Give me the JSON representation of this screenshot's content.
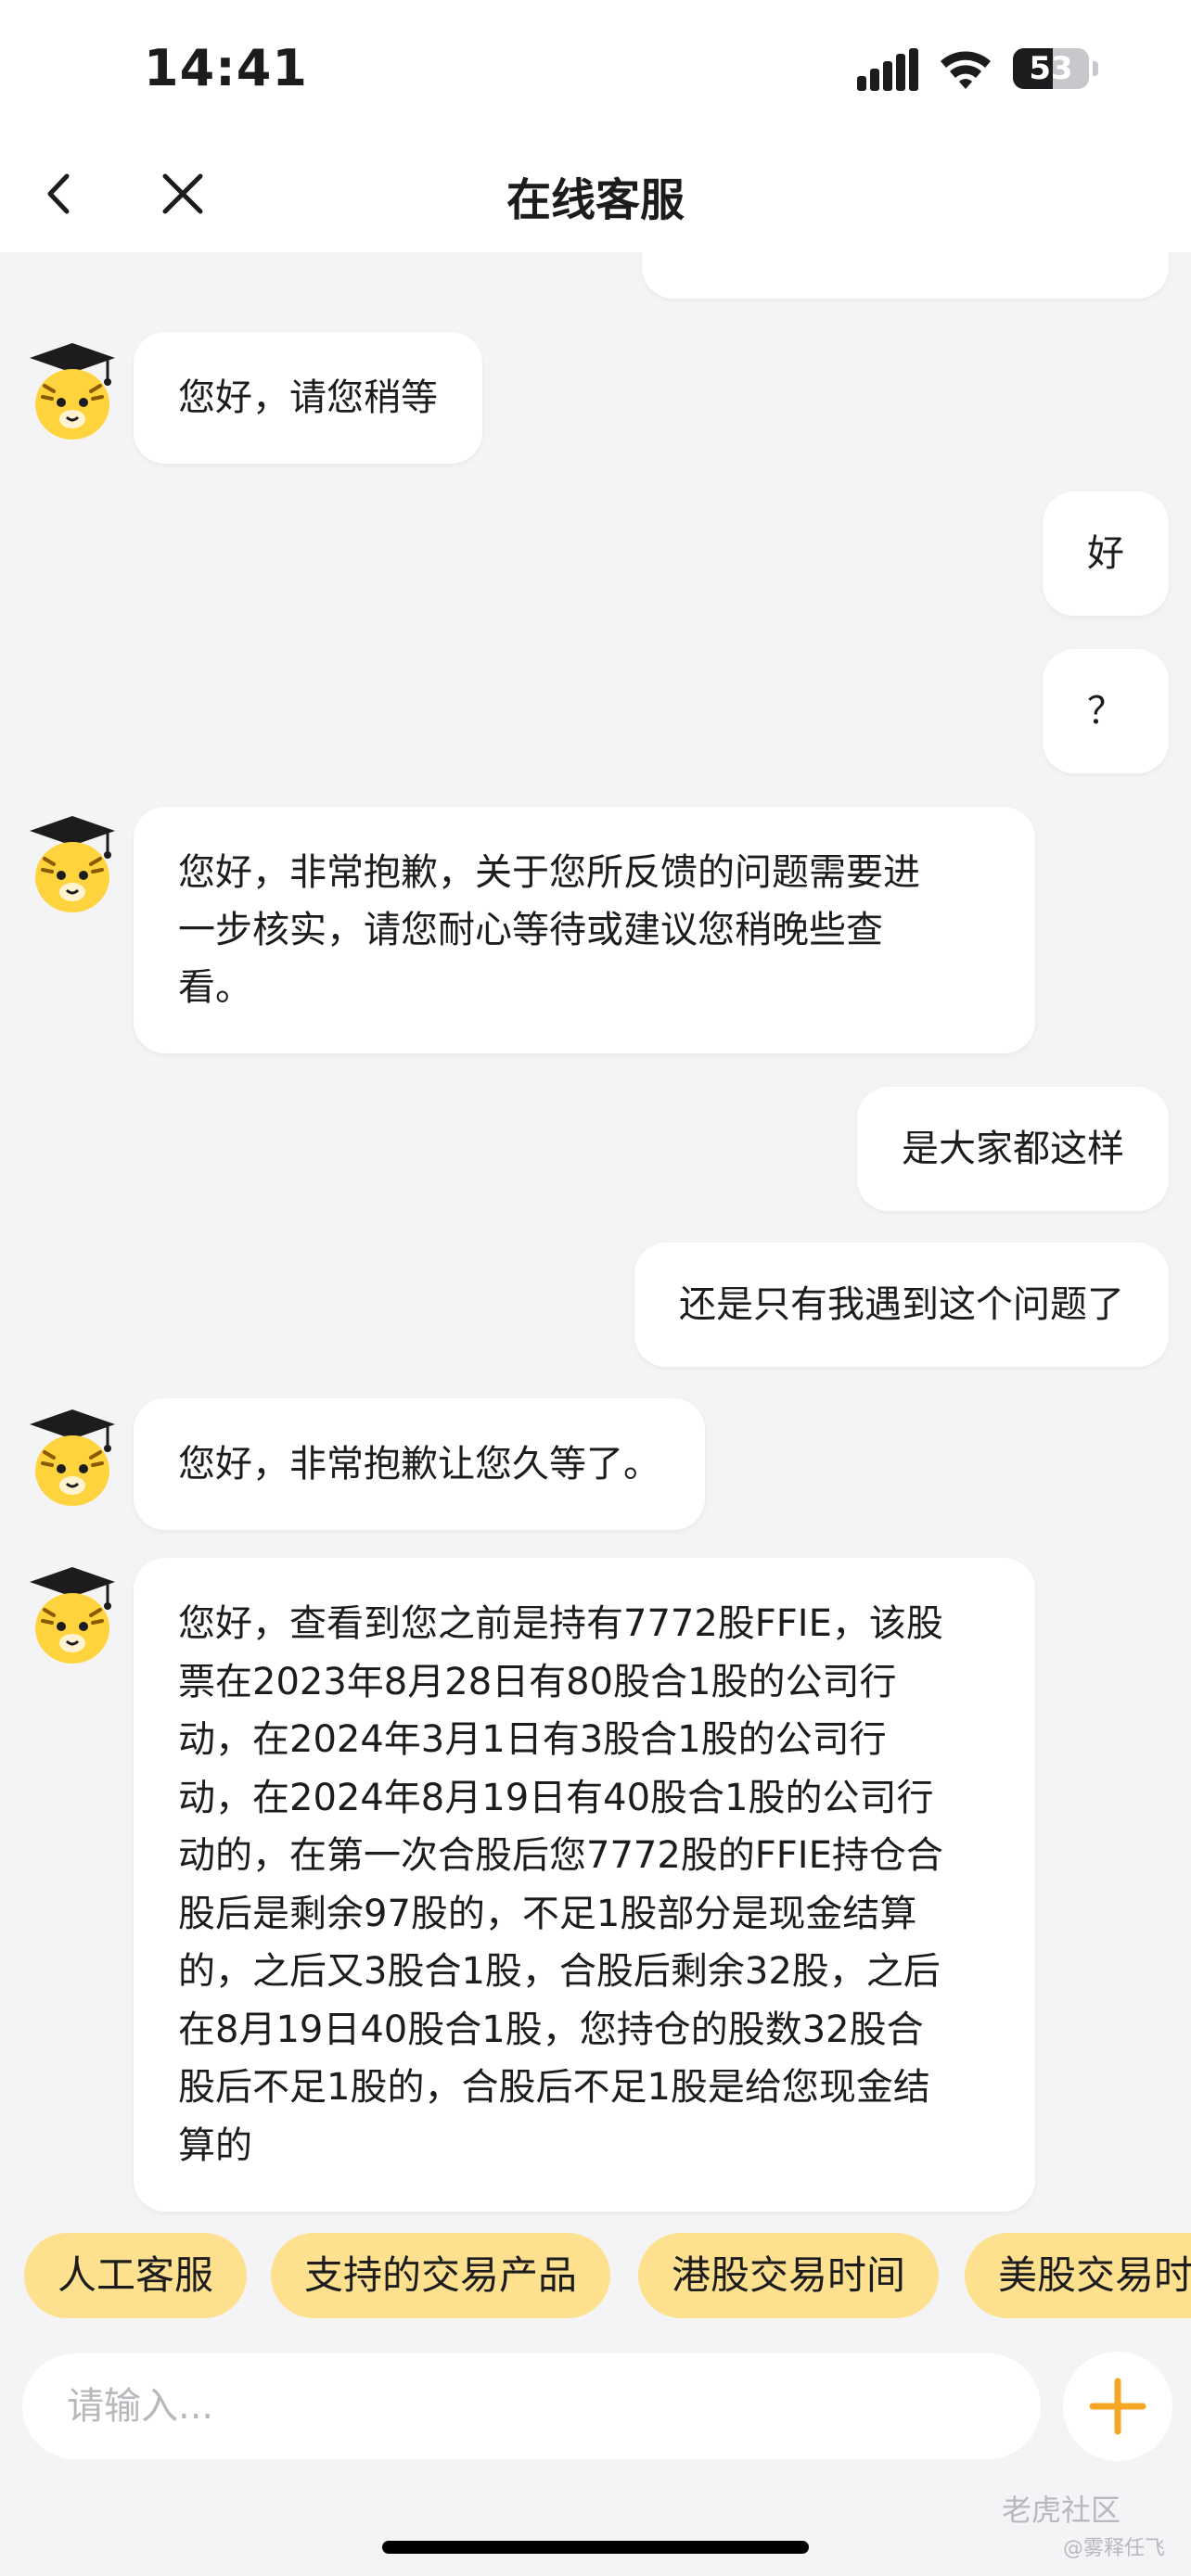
{
  "status_bar": {
    "time": "14:41",
    "battery": "53",
    "battery_level": 0.53
  },
  "header": {
    "title": "在线客服"
  },
  "colors": {
    "accent_yellow": "#fee18e",
    "plus_orange": "#f5a623",
    "bubble_bg": "#ffffff",
    "chat_bg": "#f4f4f6"
  },
  "messages": [
    {
      "from": "agent",
      "text": "您好，请您稍等"
    },
    {
      "from": "user",
      "text": "好"
    },
    {
      "from": "user",
      "text": "？"
    },
    {
      "from": "agent",
      "lines": [
        "您好，非常抱歉，关于您所反馈的问题需要进",
        "一步核实，请您耐心等待或建议您稍晚些查",
        "看。"
      ]
    },
    {
      "from": "user",
      "text": "是大家都这样"
    },
    {
      "from": "user",
      "text": "还是只有我遇到这个问题了"
    },
    {
      "from": "agent",
      "text": "您好，非常抱歉让您久等了。"
    },
    {
      "from": "agent",
      "lines": [
        "您好，查看到您之前是持有7772股FFIE，该股",
        "票在2023年8月28日有80股合1股的公司行",
        "动，在2024年3月1日有3股合1股的公司行",
        "动，在2024年8月19日有40股合1股的公司行",
        "动的，在第一次合股后您7772股的FFIE持仓合",
        "股后是剩余97股的，不足1股部分是现金结算",
        "的，之后又3股合1股，合股后剩余32股，之后",
        "在8月19日40股合1股，您持仓的股数32股合",
        "股后不足1股的，合股后不足1股是给您现金结",
        "算的"
      ]
    }
  ],
  "quick_replies": [
    "人工客服",
    "支持的交易产品",
    "港股交易时间",
    "美股交易时间"
  ],
  "composer": {
    "placeholder": "请输入..."
  },
  "watermark": {
    "brand": "老虎社区",
    "user": "@雾释任飞"
  }
}
